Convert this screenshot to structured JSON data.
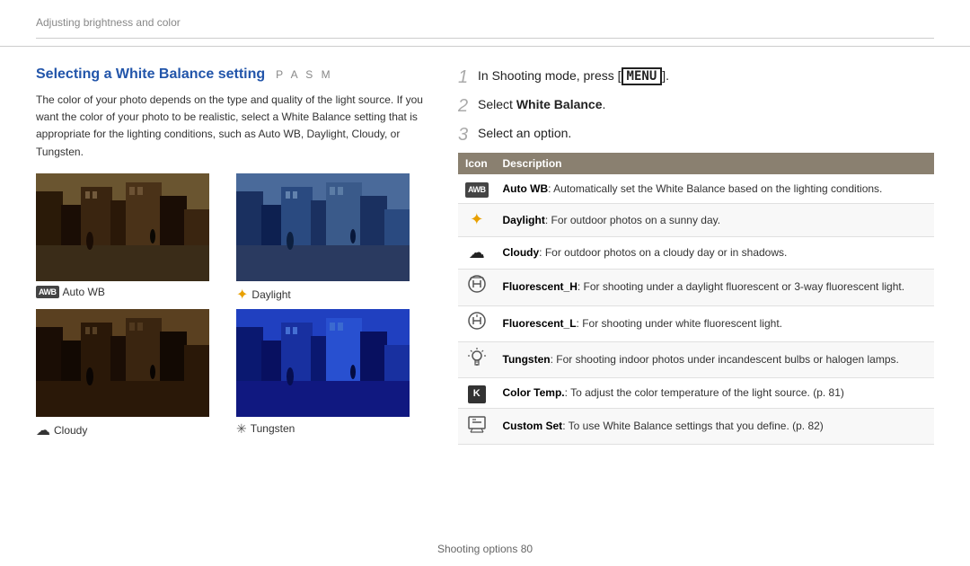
{
  "breadcrumb": "Adjusting brightness and color",
  "left": {
    "title": "Selecting a White Balance setting",
    "pasm": "P A S M",
    "description": "The color of your photo depends on the type and quality of the light source. If you want the color of your photo to be realistic, select a White Balance setting that is appropriate for the lighting conditions, such as Auto WB, Daylight, Cloudy, or Tungsten.",
    "photos": [
      {
        "id": "autowb",
        "caption": "Auto WB",
        "icon": "awb"
      },
      {
        "id": "daylight",
        "caption": "Daylight",
        "icon": "sun"
      },
      {
        "id": "cloudy",
        "caption": "Cloudy",
        "icon": "cloud"
      },
      {
        "id": "tungsten",
        "caption": "Tungsten",
        "icon": "tungsten"
      }
    ]
  },
  "right": {
    "steps": [
      {
        "num": "1",
        "text": "In Shooting mode, press [MENU]."
      },
      {
        "num": "2",
        "text": "Select White Balance."
      },
      {
        "num": "3",
        "text": "Select an option."
      }
    ],
    "table": {
      "headers": [
        "Icon",
        "Description"
      ],
      "rows": [
        {
          "icon": "awb-box",
          "desc_bold": "Auto WB",
          "desc": ": Automatically set the White Balance based on the lighting conditions."
        },
        {
          "icon": "sun",
          "desc_bold": "Daylight",
          "desc": ": For outdoor photos on a sunny day."
        },
        {
          "icon": "cloud",
          "desc_bold": "Cloudy",
          "desc": ": For outdoor photos on a cloudy day or in shadows."
        },
        {
          "icon": "fluor-h",
          "desc_bold": "Fluorescent_H",
          "desc": ": For shooting under a daylight fluorescent or 3-way fluorescent light."
        },
        {
          "icon": "fluor-l",
          "desc_bold": "Fluorescent_L",
          "desc": ": For shooting under white fluorescent light."
        },
        {
          "icon": "tungsten",
          "desc_bold": "Tungsten",
          "desc": ": For shooting indoor photos under incandescent bulbs or halogen lamps."
        },
        {
          "icon": "k-box",
          "desc_bold": "Color Temp.",
          "desc": ": To adjust the color temperature of the light source. (p. 81)"
        },
        {
          "icon": "custom",
          "desc_bold": "Custom Set",
          "desc": ": To use White Balance settings that you define. (p. 82)"
        }
      ]
    }
  },
  "footer": "Shooting options  80"
}
